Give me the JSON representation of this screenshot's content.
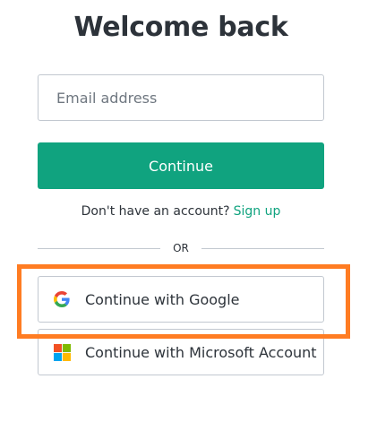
{
  "header": {
    "title": "Welcome back"
  },
  "form": {
    "email_placeholder": "Email address",
    "email_value": "",
    "continue_label": "Continue"
  },
  "signup": {
    "prompt": "Don't have an account?",
    "link_label": "Sign up"
  },
  "divider": {
    "label": "OR"
  },
  "social": {
    "google_label": "Continue with Google",
    "google_icon": "google-icon",
    "microsoft_label": "Continue with Microsoft Account",
    "microsoft_icon": "microsoft-icon"
  },
  "colors": {
    "accent": "#10a37f",
    "text": "#2d333a",
    "border": "#c2c8d0",
    "highlight": "#ff7c22"
  }
}
